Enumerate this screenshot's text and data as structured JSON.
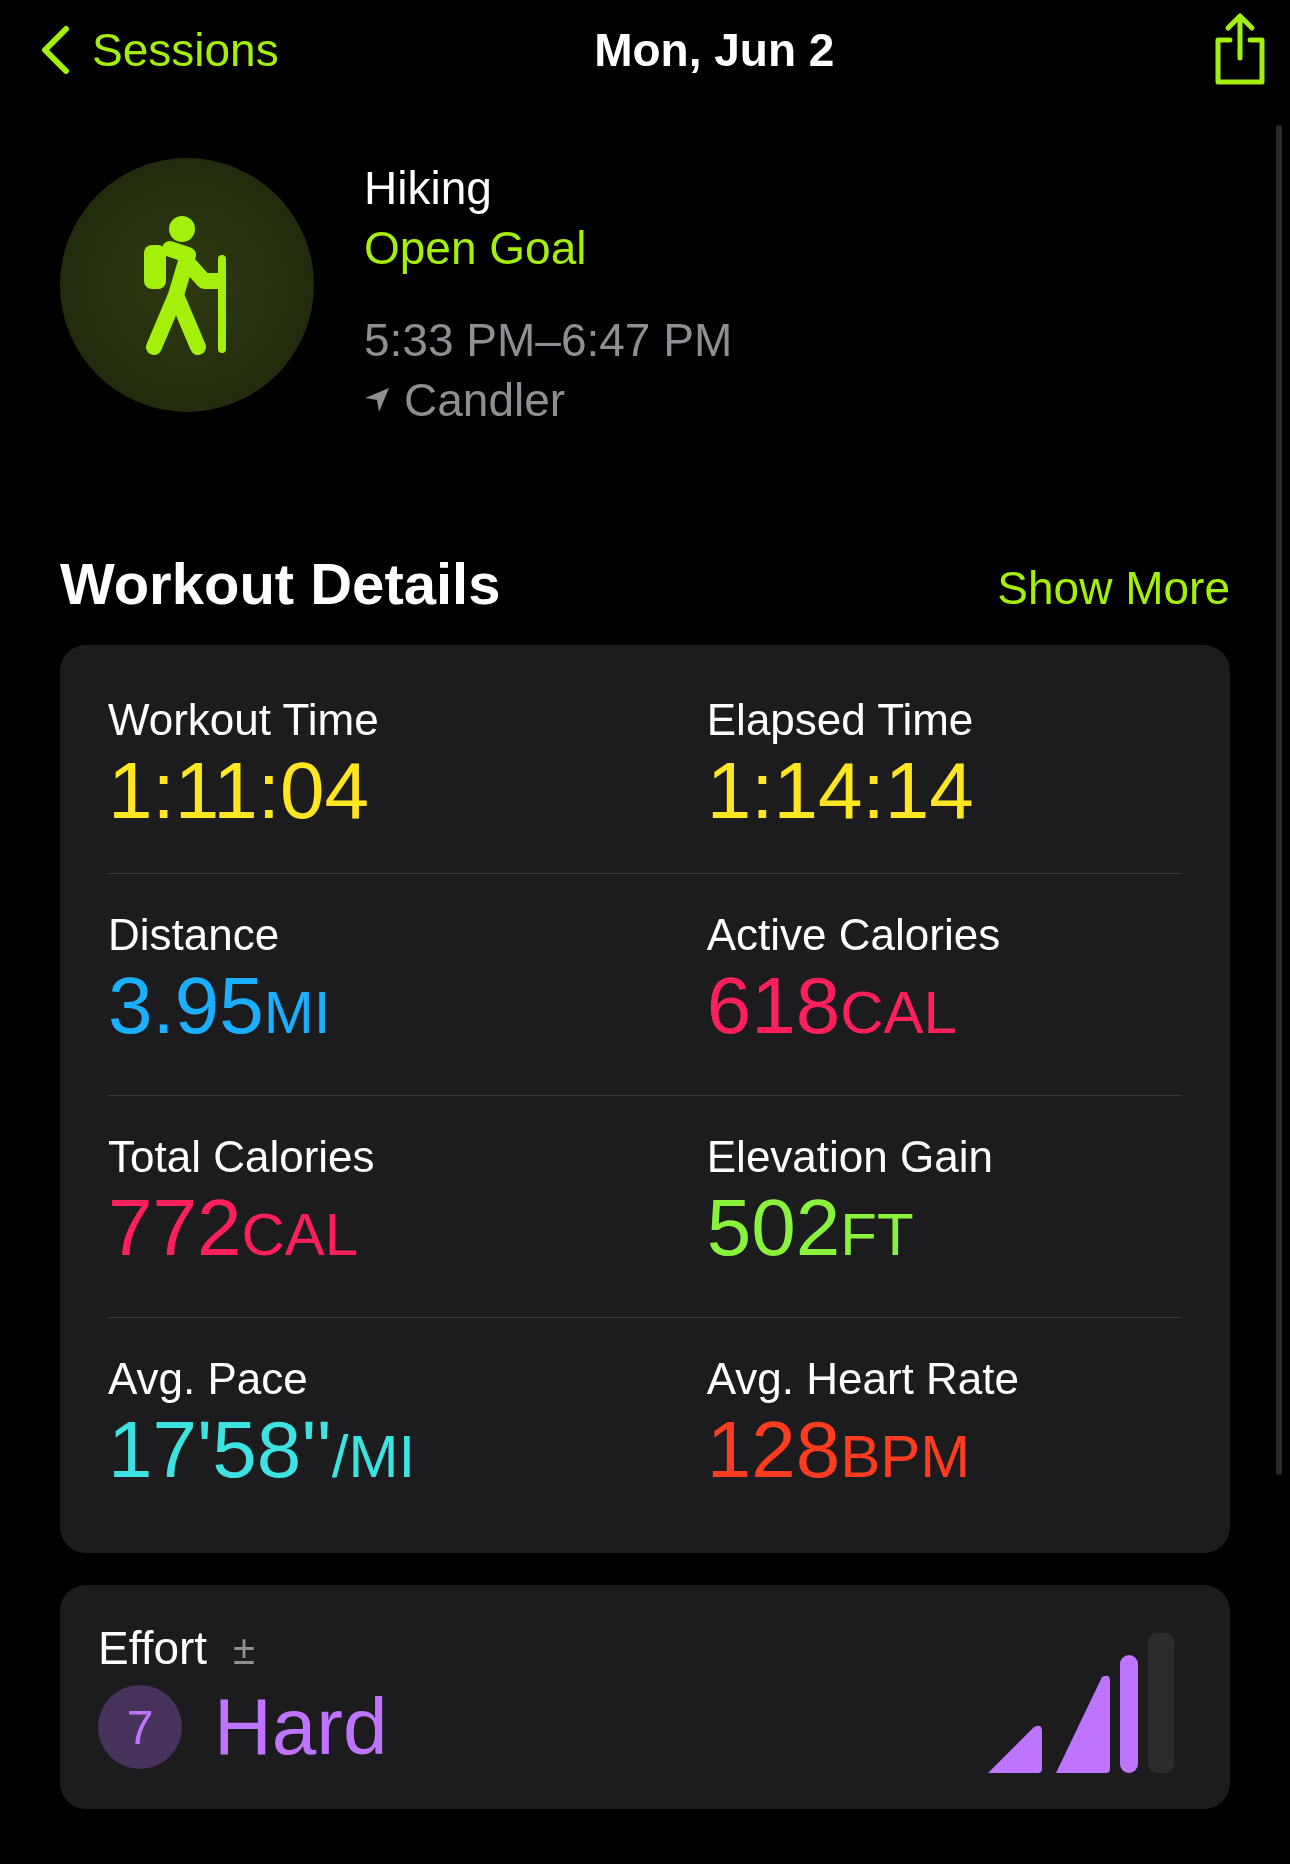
{
  "nav": {
    "back_label": "Sessions",
    "title": "Mon, Jun 2"
  },
  "workout": {
    "type": "Hiking",
    "goal": "Open Goal",
    "time_range": "5:33 PM–6:47 PM",
    "location": "Candler"
  },
  "details": {
    "title": "Workout Details",
    "action": "Show More",
    "metrics": [
      {
        "label": "Workout Time",
        "value": "1:11:04",
        "color": "#ffe620"
      },
      {
        "label": "Elapsed Time",
        "value": "1:14:14",
        "color": "#ffe620"
      },
      {
        "label": "Distance",
        "value": "3.95",
        "unit": "MI",
        "color": "#1ab0ff"
      },
      {
        "label": "Active Calories",
        "value": "618",
        "unit": "CAL",
        "color": "#ff1f5a"
      },
      {
        "label": "Total Calories",
        "value": "772",
        "unit": "CAL",
        "color": "#ff1f5a"
      },
      {
        "label": "Elevation Gain",
        "value": "502",
        "unit": "FT",
        "color": "#8af23c"
      },
      {
        "label": "Avg. Pace",
        "value": "17'58''",
        "unit": "/MI",
        "color": "#3ce3e0"
      },
      {
        "label": "Avg. Heart Rate",
        "value": "128",
        "unit": "BPM",
        "color": "#ff3b20"
      }
    ]
  },
  "effort": {
    "label": "Effort",
    "adjust": "±",
    "score": "7",
    "rating": "Hard"
  }
}
